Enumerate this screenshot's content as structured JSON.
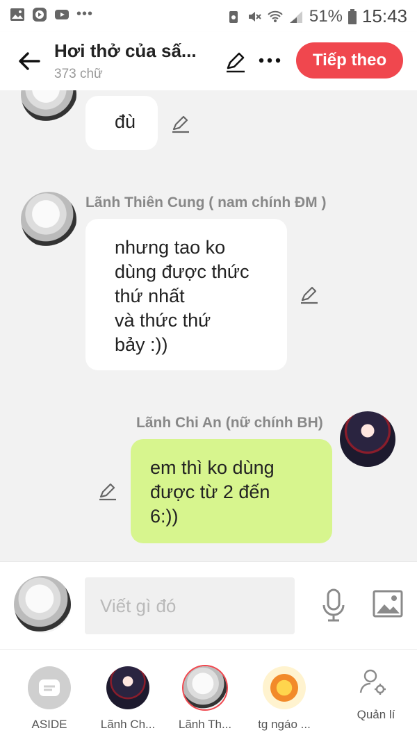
{
  "status": {
    "battery_percent": "51%",
    "time": "15:43",
    "left_icons": [
      "image-icon",
      "video-player-icon",
      "youtube-icon",
      "more-dots-icon"
    ],
    "right_icons": [
      "recycle-icon",
      "mute-icon",
      "wifi-icon",
      "signal-icon",
      "battery-icon"
    ]
  },
  "header": {
    "title": "Hơi thở của sấ...",
    "word_count": "373 chữ",
    "next_button": "Tiếp theo"
  },
  "messages": [
    {
      "sender": "",
      "text": "đù",
      "side": "left"
    },
    {
      "sender": "Lãnh Thiên Cung ( nam chính ĐM )",
      "text_lines": [
        "nhưng tao ko",
        "dùng được thức",
        "thứ nhất",
        "và thức thứ",
        "bảy :))"
      ],
      "side": "left"
    },
    {
      "sender": "Lãnh Chi An (nữ chính BH)",
      "text_lines": [
        "em thì ko dùng",
        "được từ 2 đến",
        "6:))"
      ],
      "side": "right"
    }
  ],
  "composer": {
    "placeholder": "Viết gì đó"
  },
  "bottom_nav": [
    {
      "label": "ASIDE",
      "icon": "aside-chat-icon"
    },
    {
      "label": "Lãnh Ch..."
    },
    {
      "label": "Lãnh Th..."
    },
    {
      "label": "tg ngáo ..."
    },
    {
      "label": "Quản lí",
      "icon": "manage-user-settings-icon"
    }
  ],
  "colors": {
    "accent": "#f0474e",
    "bubble_self": "#d7f58e",
    "bubble_other": "#ffffff",
    "background": "#f2f2f2"
  }
}
